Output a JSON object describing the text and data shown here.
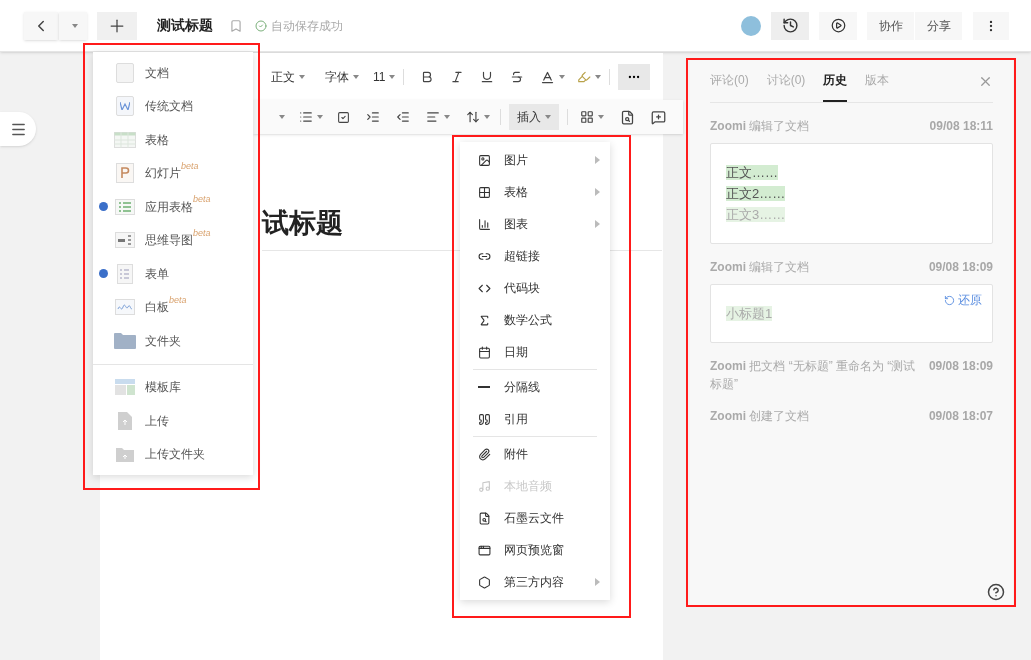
{
  "top_bar": {
    "title": "测试标题",
    "save_status": "自动保存成功",
    "buttons": [
      "协作",
      "分享"
    ]
  },
  "toolbar": {
    "style": "正文",
    "font": "字体",
    "size": "11",
    "insert": "插入"
  },
  "document": {
    "title": "试标题"
  },
  "new_menu": {
    "items": [
      {
        "label": "文档",
        "marked": false
      },
      {
        "label": "传统文档",
        "marked": false
      },
      {
        "label": "表格",
        "marked": false
      },
      {
        "label": "幻灯片",
        "badge": "beta",
        "marked": false
      },
      {
        "label": "应用表格",
        "badge": "beta",
        "marked": true
      },
      {
        "label": "思维导图",
        "badge": "beta",
        "marked": false
      },
      {
        "label": "表单",
        "marked": true
      },
      {
        "label": "白板",
        "badge": "beta",
        "marked": false
      },
      {
        "label": "文件夹",
        "marked": false
      }
    ],
    "bottom_items": [
      "模板库",
      "上传",
      "上传文件夹"
    ]
  },
  "insert_menu": {
    "groups": [
      [
        {
          "label": "图片",
          "submenu": true,
          "disabled": false
        },
        {
          "label": "表格",
          "submenu": true,
          "disabled": false
        },
        {
          "label": "图表",
          "submenu": true,
          "disabled": false
        },
        {
          "label": "超链接",
          "submenu": false,
          "disabled": false
        },
        {
          "label": "代码块",
          "submenu": false,
          "disabled": false
        },
        {
          "label": "数学公式",
          "submenu": false,
          "disabled": false
        },
        {
          "label": "日期",
          "submenu": false,
          "disabled": false
        }
      ],
      [
        {
          "label": "分隔线",
          "submenu": false,
          "disabled": false
        },
        {
          "label": "引用",
          "submenu": false,
          "disabled": false
        }
      ],
      [
        {
          "label": "附件",
          "submenu": false,
          "disabled": false
        },
        {
          "label": "本地音频",
          "submenu": false,
          "disabled": true
        },
        {
          "label": "石墨云文件",
          "submenu": false,
          "disabled": false
        },
        {
          "label": "网页预览窗",
          "submenu": false,
          "disabled": false
        },
        {
          "label": "第三方内容",
          "submenu": true,
          "disabled": false
        }
      ]
    ]
  },
  "history_panel": {
    "tabs": [
      {
        "label": "评论(0)",
        "selected": false
      },
      {
        "label": "讨论(0)",
        "selected": false
      },
      {
        "label": "历史",
        "selected": true
      },
      {
        "label": "版本",
        "selected": false
      }
    ],
    "entries": [
      {
        "user": "Zoomi",
        "action": "编辑了文档",
        "time": "09/08 18:11",
        "lines": [
          {
            "text": "正文……",
            "faded": false
          },
          {
            "text": "正文2……",
            "faded": false
          },
          {
            "text": "正文3……",
            "faded": true
          }
        ]
      },
      {
        "user": "Zoomi",
        "action": "编辑了文档",
        "time": "09/08 18:09",
        "restore": "还原",
        "lines": [
          {
            "text": "小标题1",
            "faded": true
          }
        ]
      },
      {
        "user": "Zoomi",
        "action": "把文档 “无标题” 重命名为 “测试标题”",
        "time": "09/08 18:09"
      },
      {
        "user": "Zoomi",
        "action": "创建了文档",
        "time": "09/08 18:07"
      }
    ]
  }
}
